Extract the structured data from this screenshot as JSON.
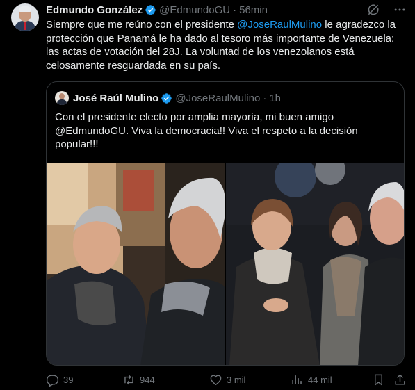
{
  "tweet": {
    "author_name": "Edmundo González",
    "author_handle": "@EdmundoGU",
    "time": "56min",
    "text_before": "Siempre que me reúno con el presidente ",
    "mention": "@JoseRaulMulino",
    "text_after": " le agradezco la protección que Panamá le ha dado al tesoro más importante de Venezuela: las actas de votación del 28J. La voluntad de los venezolanos está celosamente resguardada en su país."
  },
  "quote": {
    "author_name": "José Raúl Mulino",
    "author_handle": "@JoseRaulMulino",
    "time": "1h",
    "text": "Con el presidente electo por amplia mayoría, mi buen amigo @EdmundoGU. Viva la democracia!! Viva el respeto a la decisión popular!!!"
  },
  "separator": "·",
  "stats": {
    "replies": "39",
    "reposts": "944",
    "likes": "3 mil",
    "views": "44 mil"
  },
  "icons": {
    "verified": "verified-badge-icon",
    "grok": "grok-icon",
    "more": "more-icon",
    "reply": "reply-icon",
    "retweet": "retweet-icon",
    "like": "heart-icon",
    "views": "views-icon",
    "bookmark": "bookmark-icon",
    "share": "share-icon"
  },
  "colors": {
    "background": "#000000",
    "text": "#e7e9ea",
    "secondary": "#71767b",
    "accent": "#1d9bf0",
    "border": "#2f3336"
  }
}
